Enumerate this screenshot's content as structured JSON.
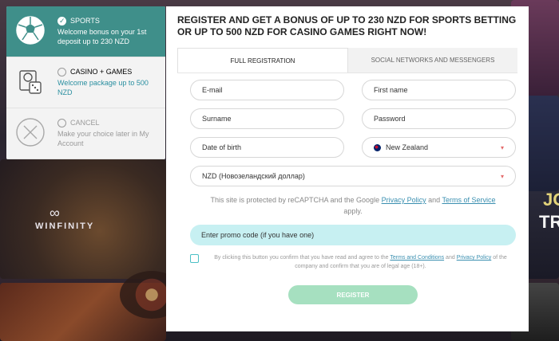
{
  "background": {
    "brand": "WINFINITY",
    "side_text_1": "JO",
    "side_text_2": "TR"
  },
  "choices": [
    {
      "title": "SPORTS",
      "description": "Welcome bonus on your 1st deposit up to 230 NZD",
      "icon": "soccer-ball-icon",
      "selected": true
    },
    {
      "title": "CASINO + GAMES",
      "description": "Welcome package up to 500 NZD",
      "icon": "casino-icon",
      "selected": false
    },
    {
      "title": "CANCEL",
      "description": "Make your choice later in My Account",
      "icon": "close-icon",
      "selected": false
    }
  ],
  "modal": {
    "title": "REGISTER AND GET A BONUS OF UP TO 230 NZD FOR SPORTS BETTING OR UP TO 500 NZD FOR CASINO GAMES RIGHT NOW!",
    "tabs": [
      {
        "label": "FULL REGISTRATION",
        "active": true
      },
      {
        "label": "SOCIAL NETWORKS AND MESSENGERS",
        "active": false
      }
    ],
    "fields": {
      "email": "E-mail",
      "first_name": "First name",
      "surname": "Surname",
      "password": "Password",
      "dob": "Date of birth",
      "country": "New Zealand",
      "currency": "NZD (Новозеландский доллар)"
    },
    "recaptcha": {
      "prefix": "This site is protected by reCAPTCHA and the Google",
      "privacy": "Privacy Policy",
      "and": "and",
      "terms": "Terms of Service",
      "suffix": "apply."
    },
    "promo": "Enter promo code (if you have one)",
    "agree": {
      "part1": "By clicking this button you confirm that you have read and agree to the",
      "terms": "Terms and Conditions",
      "and": "and",
      "privacy": "Privacy Policy",
      "part2": "of the company and confirm that you are of legal age (18+)."
    },
    "register_label": "REGISTER"
  },
  "colors": {
    "accent": "#3f8f8a",
    "promo_bg": "#c7f0f2",
    "register_bg": "#a6e0c0",
    "link": "#3a8fb0"
  }
}
